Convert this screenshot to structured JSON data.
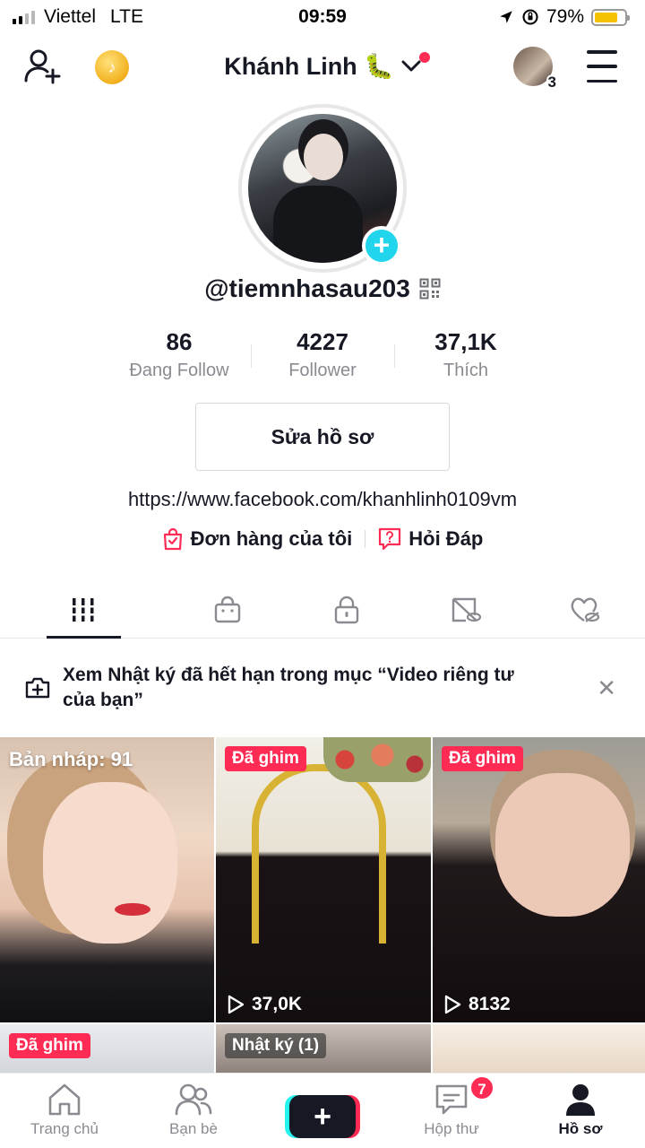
{
  "status_bar": {
    "carrier": "Viettel",
    "network": "LTE",
    "time": "09:59",
    "battery_percent": "79%",
    "battery_level": 0.79
  },
  "header": {
    "account_name": "Khánh Linh 🐛",
    "story_count": "3",
    "icons": {
      "add_friend": "person-plus-icon",
      "coin": "tiktok-coin-icon",
      "dropdown": "chevron-down-icon",
      "menu": "hamburger-menu-icon"
    }
  },
  "profile": {
    "username": "@tiemnhasau203",
    "stats": [
      {
        "value": "86",
        "label": "Đang Follow"
      },
      {
        "value": "4227",
        "label": "Follower"
      },
      {
        "value": "37,1K",
        "label": "Thích"
      }
    ],
    "edit_button": "Sửa hồ sơ",
    "bio_link": "https://www.facebook.com/khanhlinh0109vm",
    "quick_links": [
      {
        "label": "Đơn hàng của tôi",
        "icon": "shopping-bag-icon"
      },
      {
        "label": "Hỏi Đáp",
        "icon": "question-message-icon"
      }
    ]
  },
  "tabs": [
    {
      "name": "videos",
      "icon": "grid-bars-icon",
      "active": true
    },
    {
      "name": "shop",
      "icon": "shop-bag-icon",
      "active": false
    },
    {
      "name": "private",
      "icon": "lock-icon",
      "active": false
    },
    {
      "name": "hidden",
      "icon": "hidden-video-icon",
      "active": false
    },
    {
      "name": "liked",
      "icon": "hidden-heart-icon",
      "active": false
    }
  ],
  "notice": {
    "text": "Xem Nhật ký đã hết hạn trong mục “Video riêng tư của bạn”"
  },
  "videos": [
    {
      "draft_label": "Bản nháp: 91"
    },
    {
      "badge": "Đã ghim",
      "views": "37,0K"
    },
    {
      "badge": "Đã ghim",
      "views": "8132"
    },
    {
      "badge": "Đã ghim"
    },
    {
      "badge": "Nhật ký (1)"
    },
    {}
  ],
  "bottom_nav": {
    "home": "Trang chủ",
    "friends": "Bạn bè",
    "inbox": "Hộp thư",
    "inbox_badge": "7",
    "profile": "Hồ sơ",
    "create": "+"
  },
  "colors": {
    "accent_red": "#fe2c55",
    "accent_cyan": "#20d5ec",
    "text_primary": "#161823",
    "text_secondary": "#8a8b91"
  }
}
